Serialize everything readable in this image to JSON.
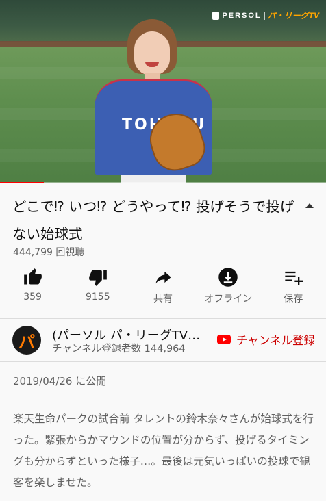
{
  "video": {
    "overlay_logo_left": "PERSOL",
    "overlay_logo_right": "パ・リーグTV",
    "jersey_text": "TOHOKU",
    "progress": 0.135,
    "progress_color": "#ff0000"
  },
  "title": "どこで⁉ いつ⁉ どうやって⁉ 投げそうで投げない始球式",
  "views": "444,799 回視聴",
  "actions": [
    {
      "icon": "thumbs-up-icon",
      "label": "359"
    },
    {
      "icon": "thumbs-down-icon",
      "label": "9155"
    },
    {
      "icon": "share-icon",
      "label": "共有"
    },
    {
      "icon": "download-icon",
      "label": "オフライン"
    },
    {
      "icon": "playlist-add-icon",
      "label": "保存"
    }
  ],
  "channel": {
    "avatar_text": "パ",
    "name": "(パーソル パ・リーグTV公式)",
    "subscribers": "チャンネル登録者数 144,964",
    "subscribe_label": "チャンネル登録",
    "subscribe_color": "#cc0000"
  },
  "published": "2019/04/26 に公開",
  "description": "楽天生命パークの試合前 タレントの鈴木奈々さんが始球式を行った。緊張からかマウンドの位置が分からず、投げるタイミングも分からずといった様子…。最後は元気いっぱいの投球で観客を楽しませた。"
}
